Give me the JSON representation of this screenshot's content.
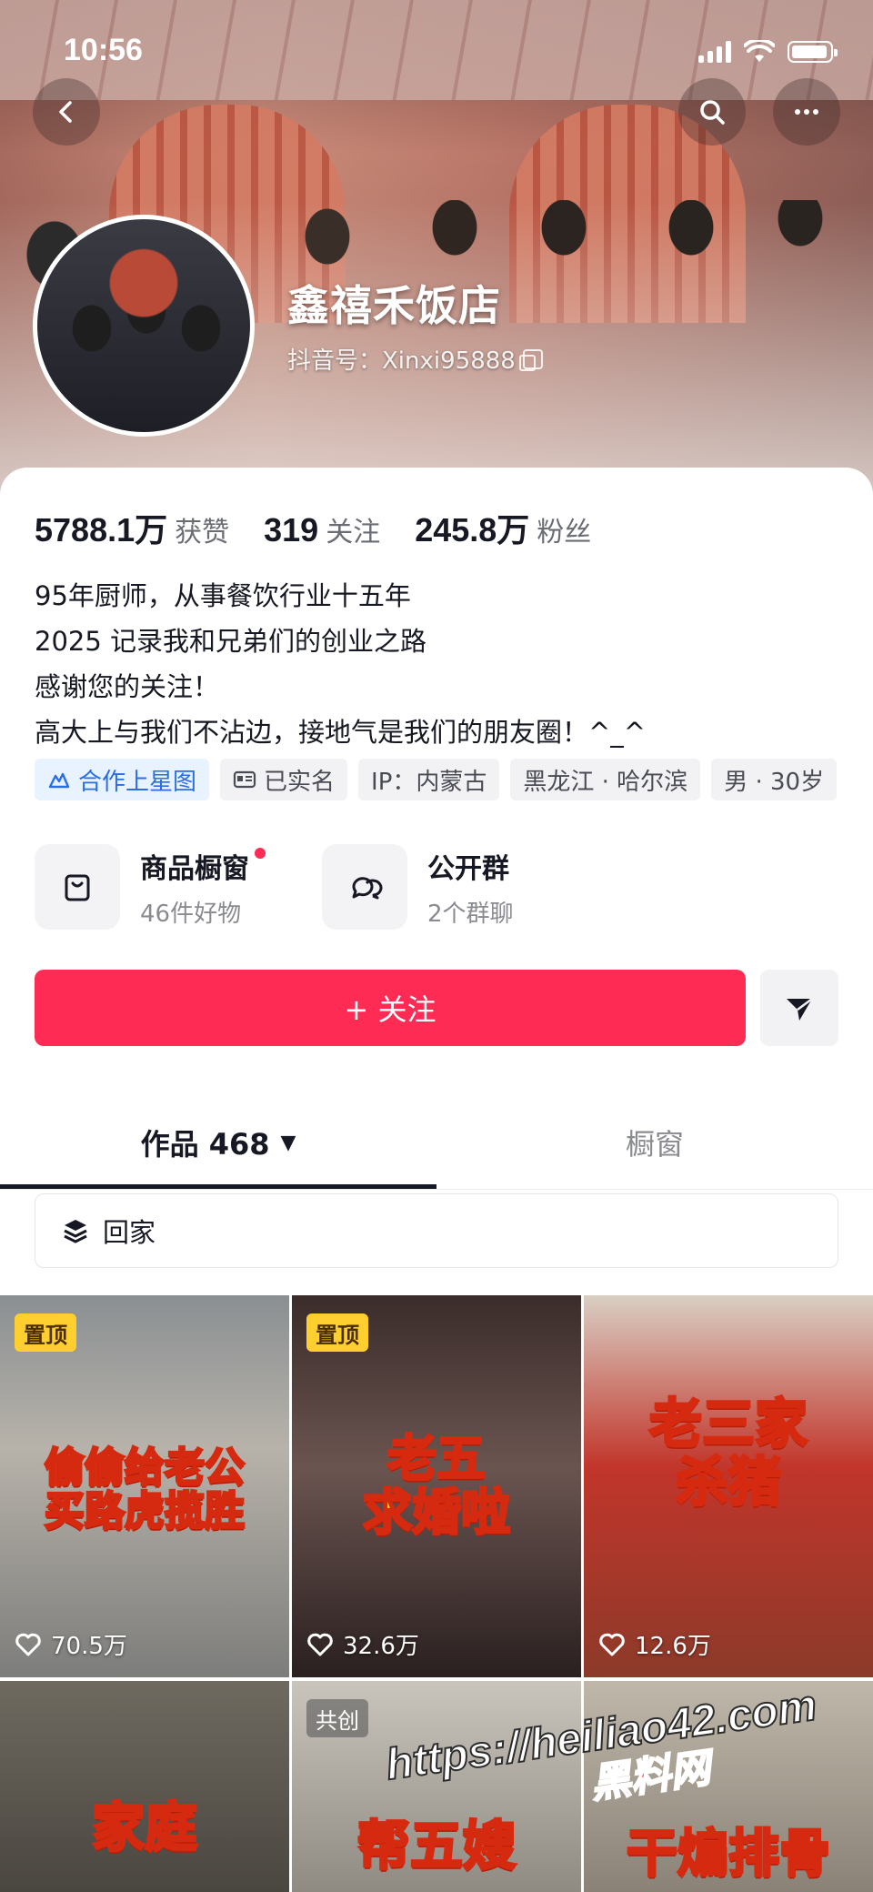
{
  "status_bar": {
    "time": "10:56",
    "battery_level": 0.95
  },
  "header": {
    "back_icon": "chevron-left-icon",
    "search_icon": "search-icon",
    "more_icon": "more-horizontal-icon"
  },
  "profile": {
    "name": "鑫禧禾饭店",
    "douyin_id": "抖音号：Xinxi95888"
  },
  "stats": [
    {
      "value": "5788.1万",
      "label": "获赞"
    },
    {
      "value": "319",
      "label": "关注"
    },
    {
      "value": "245.8万",
      "label": "粉丝"
    }
  ],
  "bio": [
    "95年厨师，从事餐饮行业十五年",
    "2025 记录我和兄弟们的创业之路",
    "感谢您的关注！",
    "高大上与我们不沾边，接地气是我们的朋友圈！^_^"
  ],
  "tags": [
    {
      "label": "合作上星图",
      "icon": "star-map-icon"
    },
    {
      "label": "已实名",
      "icon": "id-card-icon"
    },
    {
      "label": "IP：内蒙古"
    },
    {
      "label": "黑龙江 · 哈尔滨"
    },
    {
      "label": "男 · 30岁"
    }
  ],
  "features": [
    {
      "title": "商品橱窗",
      "subtitle": "46件好物",
      "icon": "shopping-bag-icon"
    },
    {
      "title": "公开群",
      "subtitle": "2个群聊",
      "icon": "chat-bubbles-icon"
    }
  ],
  "follow_button": "+ 关注",
  "tabs": [
    {
      "label": "作品 468",
      "caret": "▼"
    },
    {
      "label": "橱窗"
    }
  ],
  "collection": {
    "label": "回家",
    "icon": "layers-icon"
  },
  "videos": [
    {
      "caption_line1": "偷偷给老公",
      "caption_line2": "买路虎揽胜",
      "badge": "置顶",
      "likes": "70.5万"
    },
    {
      "caption_line1": "老五",
      "caption_line2": "求婚啦",
      "badge": "置顶",
      "likes": "32.6万"
    },
    {
      "caption_line1": "老三家",
      "caption_line2": "杀猪",
      "badge": "",
      "likes": "12.6万"
    },
    {
      "caption_line1": "家庭",
      "caption_line2": "",
      "badge": "",
      "likes": ""
    },
    {
      "caption_line1": "帮五嫂",
      "caption_line2": "",
      "badge": "共创",
      "likes": ""
    },
    {
      "caption_line1": "干煸排骨",
      "caption_line2": "",
      "badge": "",
      "likes": ""
    }
  ],
  "watermark": {
    "url": "https://heiliao42.com",
    "text": "黑料网"
  },
  "colors": {
    "accent": "#fe2c55",
    "caption_yellow": "#ffe033",
    "caption_red": "#d52a10",
    "pin_badge": "#ffcf2f"
  }
}
